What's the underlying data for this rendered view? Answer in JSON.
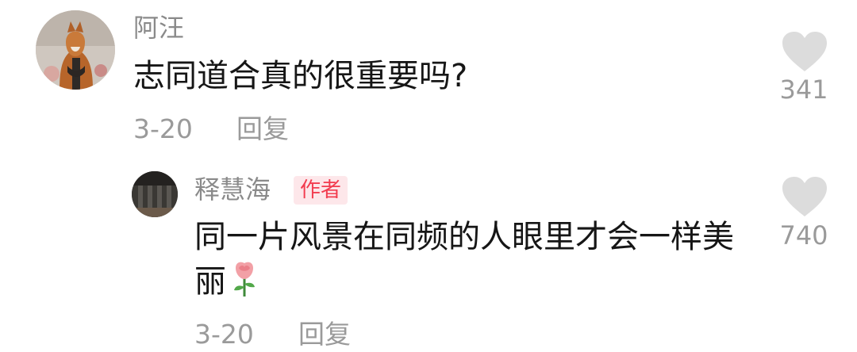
{
  "comments": [
    {
      "author": "阿汪",
      "text": "志同道合真的很重要吗?",
      "date": "3-20",
      "reply_label": "回复",
      "likes": "341",
      "avatar_icon": "dog-avatar"
    },
    {
      "author": "释慧海",
      "badge": "作者",
      "text": "同一片风景在同频的人眼里才会一样美丽",
      "emoji": "rose-emoji",
      "date": "3-20",
      "reply_label": "回复",
      "likes": "740",
      "avatar_icon": "dark-photo-avatar"
    }
  ],
  "colors": {
    "like_icon": "#dcdcdc",
    "badge_bg": "#fde7ea",
    "badge_text": "#f23c4f",
    "meta_text": "#9a9a9a",
    "body_text": "#161616"
  }
}
